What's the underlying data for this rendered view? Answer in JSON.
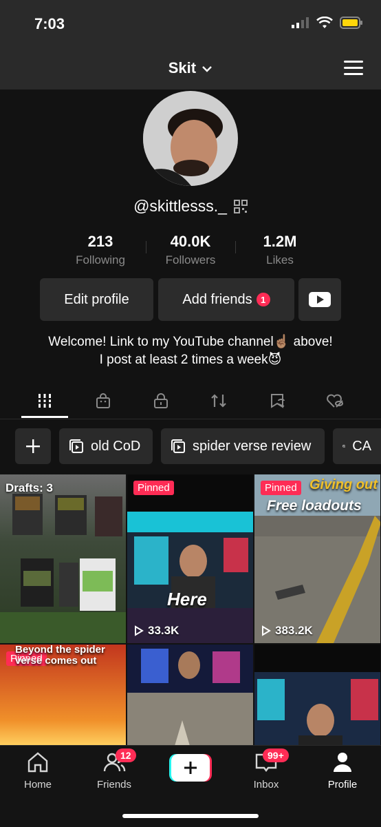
{
  "status": {
    "time": "7:03"
  },
  "header": {
    "title": "Skit"
  },
  "profile": {
    "username": "@skittlesss._",
    "stats": [
      {
        "value": "213",
        "label": "Following"
      },
      {
        "value": "40.0K",
        "label": "Followers"
      },
      {
        "value": "1.2M",
        "label": "Likes"
      }
    ],
    "edit_label": "Edit profile",
    "add_friends_label": "Add friends",
    "add_friends_badge": "1",
    "bio_line1": "Welcome! Link to my YouTube channel☝🏽 above!",
    "bio_line2": "I post at least 2 times a week😈"
  },
  "playlists": [
    "old CoD",
    "spider verse review",
    "CA"
  ],
  "videos": {
    "drafts": "Drafts: 3",
    "pinned": "Pinned",
    "v2_views": "33.3K",
    "v2_overlay": "Here",
    "v3_views": "383.2K",
    "v3_overlay1": "Giving out",
    "v3_overlay2": "Free loadouts",
    "v4_overlay": "Beyond the spider verse comes out"
  },
  "nav": {
    "home": "Home",
    "friends": "Friends",
    "friends_badge": "12",
    "inbox": "Inbox",
    "inbox_badge": "99+",
    "profile": "Profile"
  },
  "colors": {
    "accent": "#fe2c55",
    "bg": "#121212",
    "button": "#2c2c2c"
  }
}
